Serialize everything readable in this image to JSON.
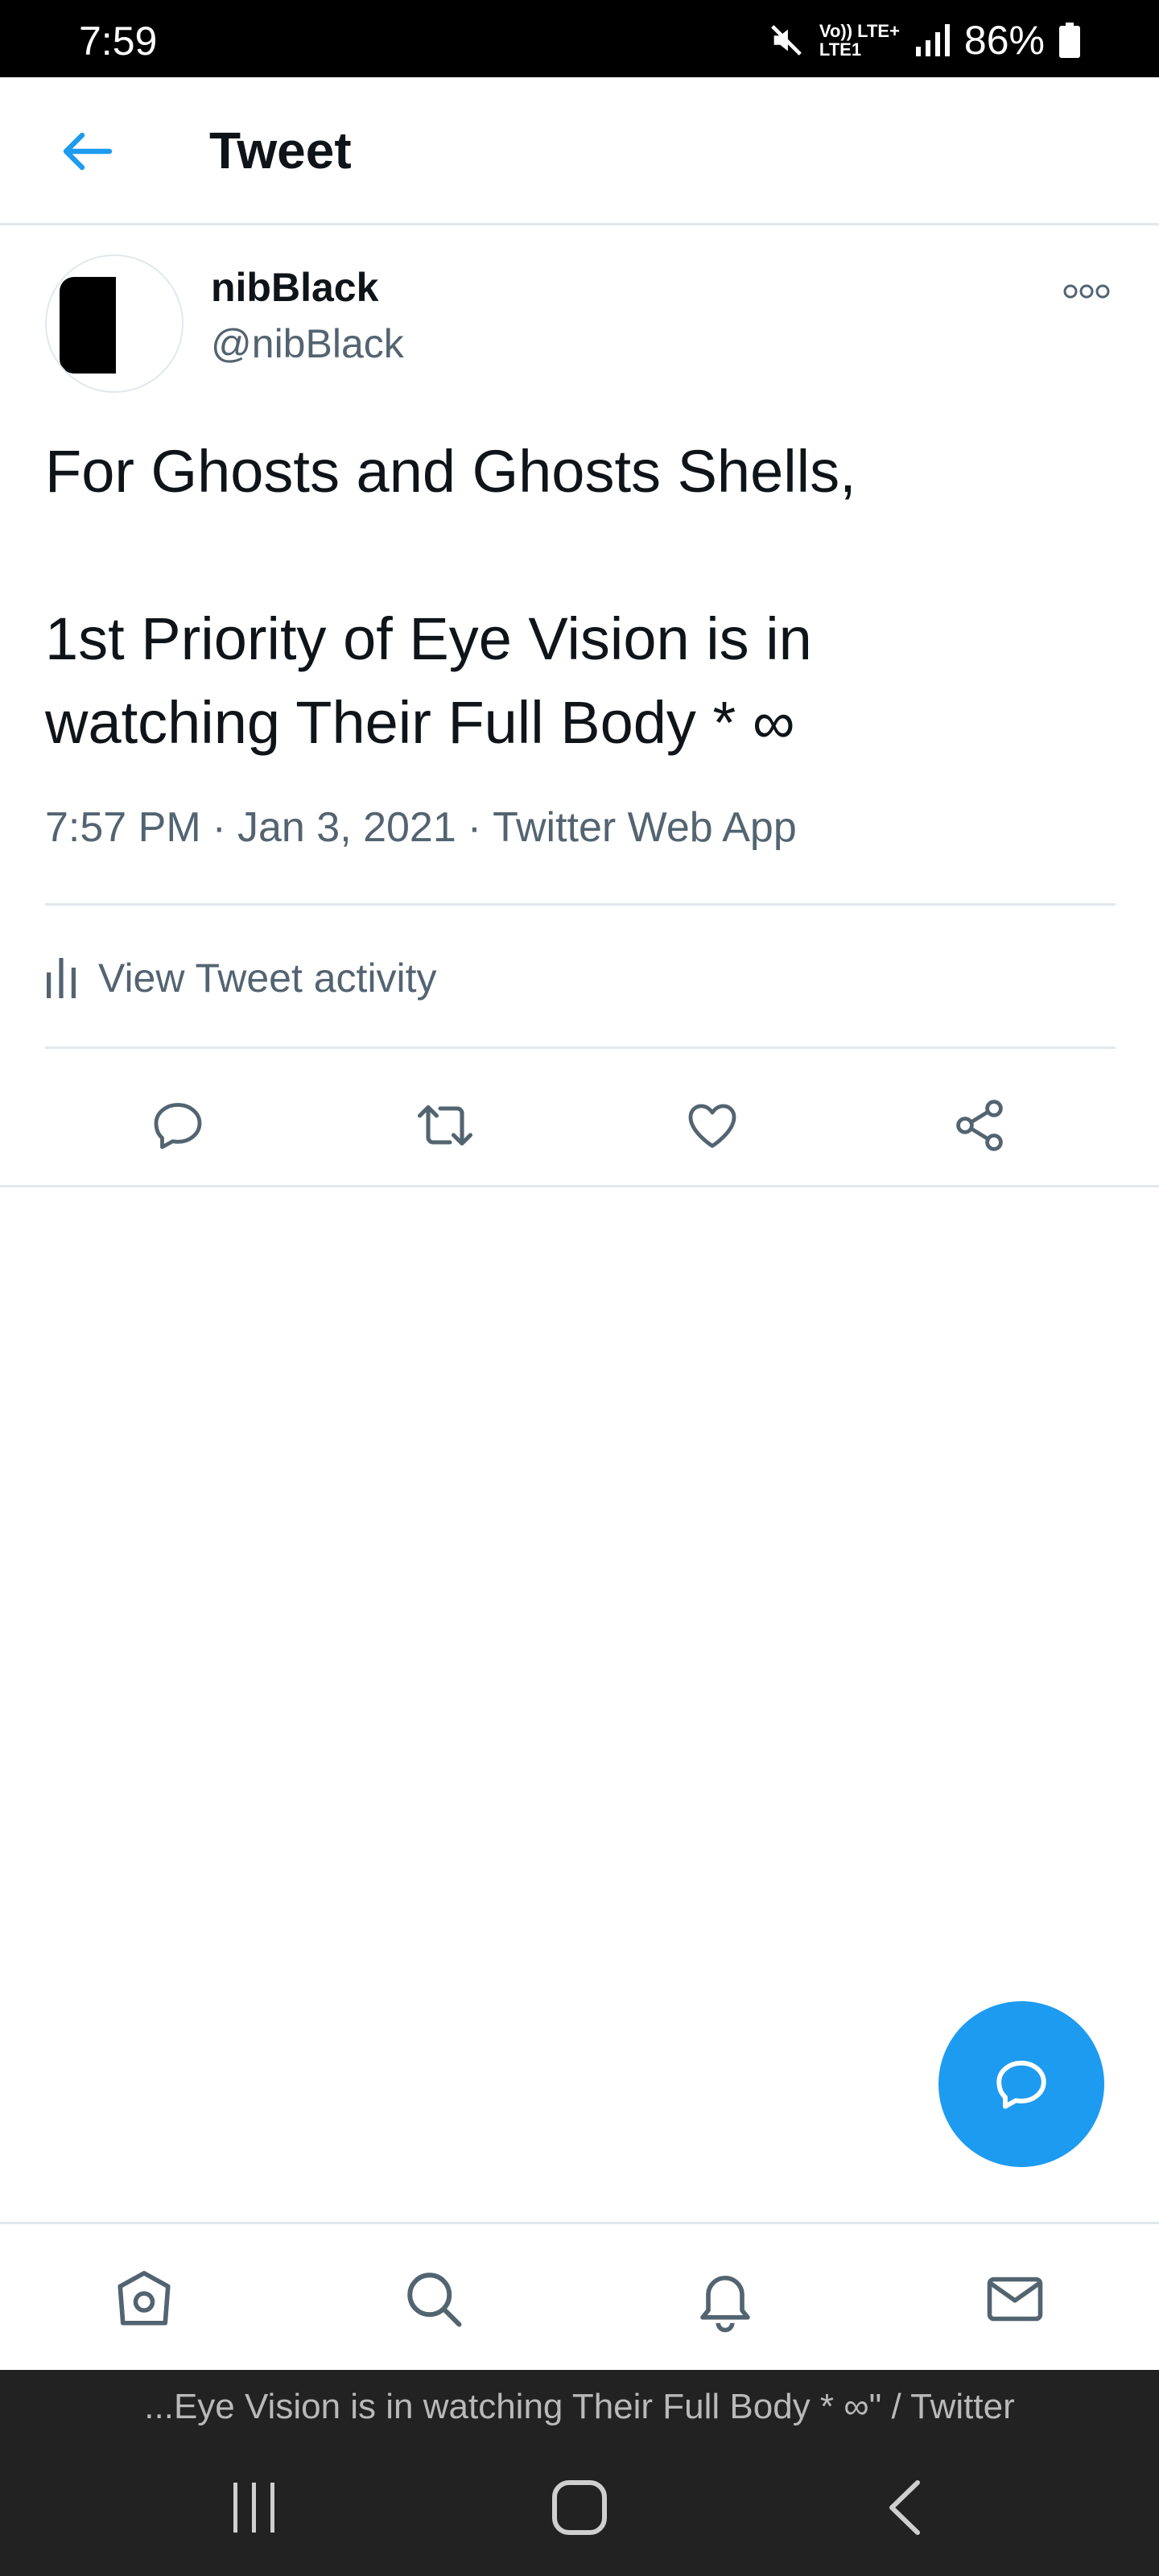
{
  "status_bar": {
    "time": "7:59",
    "network_top": "Vo)) LTE+",
    "network_bottom": "LTE1",
    "battery": "86%"
  },
  "header": {
    "title": "Tweet",
    "back_icon": "arrow-left-icon"
  },
  "tweet": {
    "author_name": "nibBlack",
    "author_handle": "@nibBlack",
    "text_line1": "For Ghosts and Ghosts Shells,",
    "text_line2": "1st Priority of Eye Vision is in",
    "text_line3": "watching Their Full Body * ∞",
    "time": "7:57 PM",
    "date": "Jan 3, 2021",
    "source": "Twitter Web App",
    "meta_separator": "·",
    "activity_label": "View Tweet activity"
  },
  "actions": [
    "reply-icon",
    "retweet-icon",
    "like-icon",
    "share-icon"
  ],
  "bottom_nav": [
    "home-icon",
    "search-icon",
    "notifications-icon",
    "messages-icon"
  ],
  "browser_title": "...Eye Vision is in watching Their Full Body * ∞\" / Twitter",
  "colors": {
    "accent": "#1d9bf0",
    "text": "#0f1419",
    "secondary_text": "#536471",
    "divider": "#e1e8ed",
    "system_bar": "#222222"
  }
}
